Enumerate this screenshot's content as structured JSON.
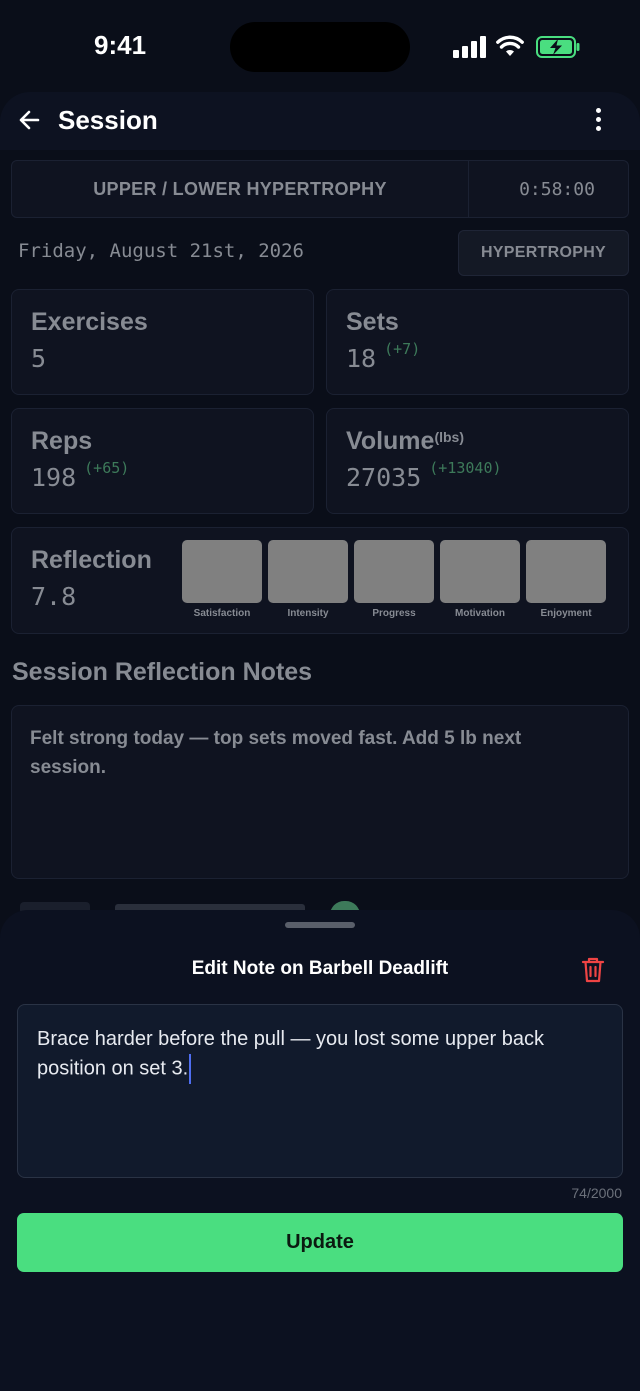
{
  "status_bar": {
    "time": "9:41"
  },
  "header": {
    "title": "Session"
  },
  "program": {
    "name": "UPPER / LOWER HYPERTROPHY",
    "timer": "0:58:00",
    "date": "Friday, August 21st, 2026",
    "tag": "HYPERTROPHY"
  },
  "stats": {
    "exercises": {
      "label": "Exercises",
      "value": "5"
    },
    "sets": {
      "label": "Sets",
      "value": "18",
      "delta": "(+7)"
    },
    "reps": {
      "label": "Reps",
      "value": "198",
      "delta": "(+65)"
    },
    "volume": {
      "label": "Volume",
      "unit": "(lbs)",
      "value": "27035",
      "delta": "(+13040)"
    }
  },
  "reflection": {
    "label": "Reflection",
    "score": "7.8",
    "categories": [
      "Satisfaction",
      "Intensity",
      "Progress",
      "Motivation",
      "Enjoyment"
    ]
  },
  "notes": {
    "heading": "Session Reflection Notes",
    "text": "Felt strong today — top sets moved fast. Add 5 lb next session."
  },
  "sheet": {
    "title": "Edit Note on Barbell Deadlift",
    "note_value": "Brace harder before the pull — you lost some upper back position on set 3.",
    "counter": "74/2000",
    "update_label": "Update"
  },
  "colors": {
    "accent_green": "#4ade80",
    "delete_red": "#ef4444",
    "delta_green": "#3d7a5a"
  },
  "icons": {
    "back": "arrow-left-icon",
    "menu": "more-vertical-icon",
    "delete": "trash-icon"
  }
}
